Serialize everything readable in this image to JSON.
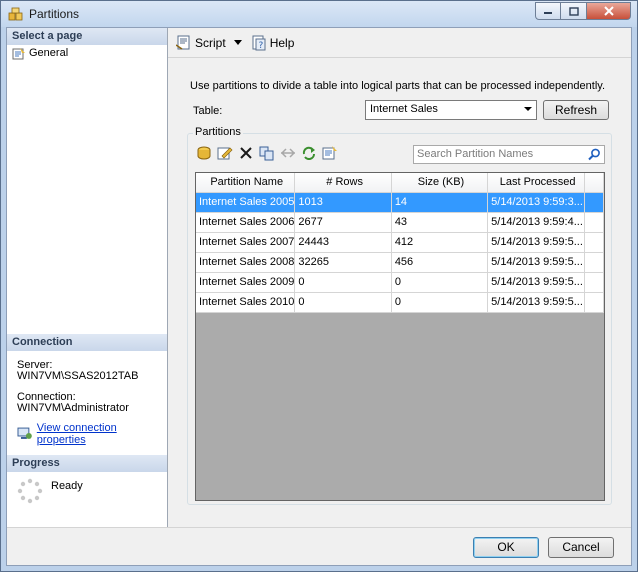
{
  "window": {
    "title": "Partitions"
  },
  "left": {
    "select_page_header": "Select a page",
    "pages": [
      {
        "label": "General"
      }
    ],
    "connection_header": "Connection",
    "server_label": "Server:",
    "server_value": "WIN7VM\\SSAS2012TAB",
    "connection_label": "Connection:",
    "connection_value": "WIN7VM\\Administrator",
    "view_link": "View connection properties",
    "progress_header": "Progress",
    "progress_status": "Ready"
  },
  "toolbar": {
    "script_label": "Script",
    "help_label": "Help"
  },
  "main": {
    "description": "Use partitions to divide a table into logical parts that can be processed independently.",
    "table_label": "Table:",
    "table_selected": "Internet Sales",
    "refresh_label": "Refresh",
    "partitions_group_label": "Partitions",
    "search_placeholder": "Search Partition Names",
    "columns": [
      "Partition Name",
      "# Rows",
      "Size (KB)",
      "Last Processed"
    ],
    "rows": [
      {
        "name": "Internet Sales 2005",
        "rows": "1013",
        "size": "14",
        "processed": "5/14/2013 9:59:3..."
      },
      {
        "name": "Internet Sales 2006",
        "rows": "2677",
        "size": "43",
        "processed": "5/14/2013 9:59:4..."
      },
      {
        "name": "Internet Sales 2007",
        "rows": "24443",
        "size": "412",
        "processed": "5/14/2013 9:59:5..."
      },
      {
        "name": "Internet Sales 2008",
        "rows": "32265",
        "size": "456",
        "processed": "5/14/2013 9:59:5..."
      },
      {
        "name": "Internet Sales 2009",
        "rows": "0",
        "size": "0",
        "processed": "5/14/2013 9:59:5..."
      },
      {
        "name": "Internet Sales 2010",
        "rows": "0",
        "size": "0",
        "processed": "5/14/2013 9:59:5..."
      }
    ]
  },
  "footer": {
    "ok_label": "OK",
    "cancel_label": "Cancel"
  }
}
